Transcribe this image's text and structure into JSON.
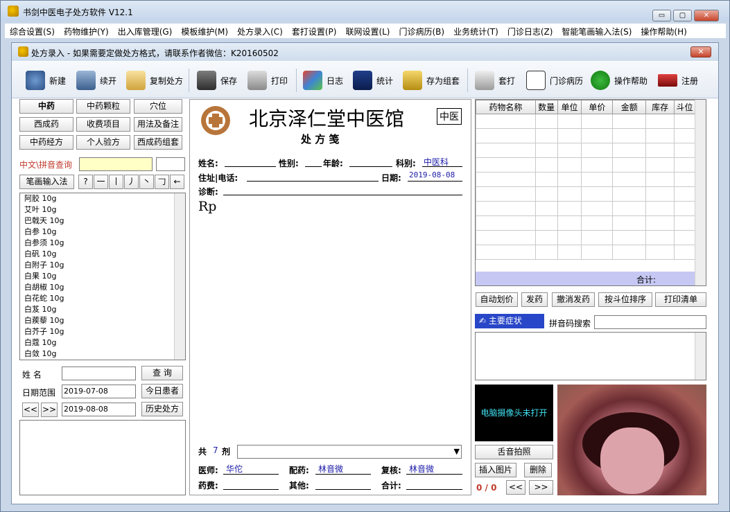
{
  "window": {
    "title": "书剑中医电子处方软件   V12.1",
    "min": "▭",
    "max": "▢",
    "close": "✕"
  },
  "menu": [
    "综合设置(S)",
    "药物维护(Y)",
    "出入库管理(G)",
    "模板维护(M)",
    "处方录入(C)",
    "套打设置(P)",
    "联网设置(L)",
    "门诊病历(B)",
    "业务统计(T)",
    "门诊日志(Z)",
    "智能笔画输入法(S)",
    "操作帮助(H)"
  ],
  "subwindow": {
    "title": "处方录入 - 如果需要定做处方格式，请联系作者微信：K20160502",
    "close": "✕"
  },
  "toolbar": {
    "new": "新建",
    "continue": "续开",
    "copy": "复制处方",
    "save": "保存",
    "print": "打印",
    "log": "日志",
    "stats": "统计",
    "group": "存为组套",
    "setprint": "套打",
    "records": "门诊病历",
    "help": "操作帮助",
    "register": "注册"
  },
  "left": {
    "tabs": [
      "中药",
      "中药颗粒",
      "穴位",
      "西成药",
      "收费项目",
      "用法及备注",
      "中药经方",
      "个人验方",
      "西成药组套"
    ],
    "search_label": "中文\\拼音查询",
    "stroke_btn": "笔画输入法",
    "strokes": [
      "?",
      "一",
      "丨",
      "丿",
      "丶",
      "𠃌",
      "←"
    ],
    "herbs": [
      "阿胶 10g",
      "艾叶 10g",
      "巴戟天 10g",
      "白参 10g",
      "白参须 10g",
      "白矾 10g",
      "白附子 10g",
      "白果 10g",
      "白胡椒 10g",
      "白花蛇 10g",
      "白芨 10g",
      "白蒺藜 10g",
      "白芥子 10g",
      "白蔻 10g",
      "白敛 10g"
    ],
    "name_label": "姓  名",
    "query_btn": "查  询",
    "date_label": "日期范围",
    "date_from": "2019-07-08",
    "date_to": "2019-08-08",
    "today_btn": "今日患者",
    "prev": "<<",
    "next": ">>",
    "history_btn": "历史处方"
  },
  "rx": {
    "clinic": "北京泽仁堂中医馆",
    "badge": "中医",
    "subtitle": "处  方  笺",
    "name": "姓名:",
    "gender": "性别:",
    "age": "年龄:",
    "dept": "科别:",
    "dept_val": "中医科",
    "addr": "住址|电话:",
    "date": "日期:",
    "date_val": "2019-08-08",
    "diag": "诊断:",
    "rp": "Rp",
    "total": "共",
    "count": "7",
    "unit": "剂",
    "doctor": "医师:",
    "doctor_val": "华佗",
    "dispense": "配药:",
    "dispense_val": "林音微",
    "review": "复核:",
    "review_val": "林音微",
    "fee": "药费:",
    "other": "其他:",
    "sum": "合计:"
  },
  "right": {
    "columns": [
      "药物名称",
      "数量",
      "单位",
      "单价",
      "金额",
      "库存",
      "斗位"
    ],
    "sum_label": "合计:",
    "buttons": [
      "自动划价",
      "发药",
      "撤消发药",
      "按斗位排序",
      "打印清单"
    ],
    "symptom": "主要症状",
    "pinyin_label": "拼音码搜索",
    "camera_text": "电脑摄像头未打开",
    "photo_btn": "舌音拍照",
    "insert_btn": "插入图片",
    "delete_btn": "删除",
    "counter": "0 / 0",
    "prev": "<<",
    "next": ">>"
  }
}
